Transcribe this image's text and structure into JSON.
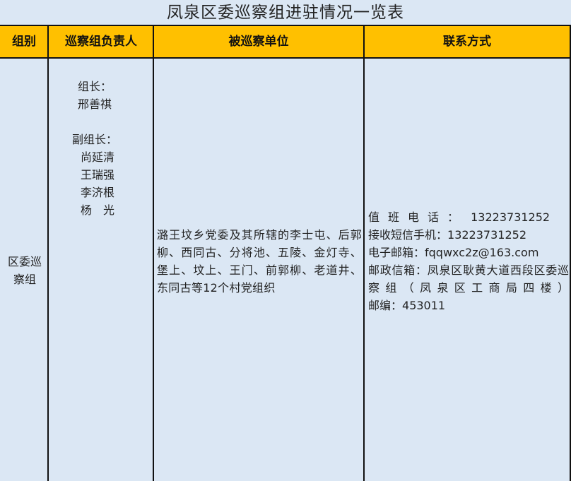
{
  "title": "凤泉区委巡察组进驻情况一览表",
  "headers": {
    "group": "组别",
    "leader": "巡察组负责人",
    "unit": "被巡察单位",
    "contact": "联系方式"
  },
  "row": {
    "group_name": "区委巡察组",
    "leaders": {
      "leader_label": "组长：",
      "leader_name": "邢善祺",
      "deputy_label": "副组长：",
      "deputies": [
        "尚延清",
        "王瑞强",
        "李济根",
        "杨　光"
      ]
    },
    "unit": "潞王坟乡党委及其所辖的李士屯、后郭柳、西同古、分将池、五陵、金灯寺、堡上、坟上、王门、前郭柳、老道井、东同古等12个村党组织",
    "contact": {
      "duty_phone_label": "值班电话：",
      "duty_phone": "13223731252",
      "sms_label": "接收短信手机：",
      "sms": "13223731252",
      "email_label": "电子邮箱：",
      "email": "fqqwxc2z@163.com",
      "mail_label": "邮政信箱：",
      "mail": "凤泉区耿黄大道西段区委巡察组（凤泉区工商局四楼）",
      "zip_label": "邮编：",
      "zip": "453011"
    }
  }
}
